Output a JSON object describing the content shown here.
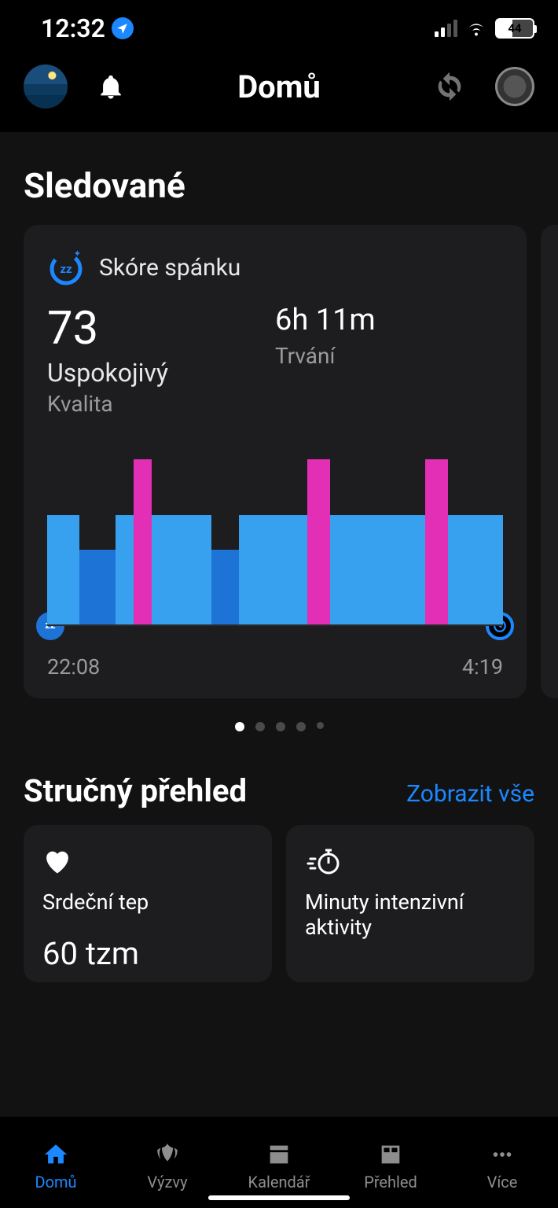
{
  "status": {
    "time": "12:32",
    "battery": "44"
  },
  "header": {
    "title": "Domů"
  },
  "sections": {
    "watched_title": "Sledované",
    "overview_title": "Stručný přehled",
    "show_all": "Zobrazit vše"
  },
  "sleep_card": {
    "title": "Skóre spánku",
    "score": "73",
    "quality_value": "Uspokojivý",
    "quality_label": "Kvalita",
    "duration_value": "6h 11m",
    "duration_label": "Trvání",
    "time_start": "22:08",
    "time_end": "4:19"
  },
  "chart_data": {
    "type": "bar",
    "title": "Skóre spánku",
    "x_start": "22:08",
    "x_end": "4:19",
    "xlabel": "",
    "ylabel": "",
    "legend": {
      "deep": "#1e74d6",
      "light": "#37a1f0",
      "rem": "#e22fb6"
    },
    "segments": [
      {
        "stage": "light",
        "left_pct": 0,
        "width_pct": 7,
        "height": 0.66
      },
      {
        "stage": "deep",
        "left_pct": 7,
        "width_pct": 8,
        "height": 0.45
      },
      {
        "stage": "light",
        "left_pct": 15,
        "width_pct": 4,
        "height": 0.66
      },
      {
        "stage": "rem",
        "left_pct": 19,
        "width_pct": 4,
        "height": 1.0
      },
      {
        "stage": "light",
        "left_pct": 23,
        "width_pct": 13,
        "height": 0.66
      },
      {
        "stage": "deep",
        "left_pct": 36,
        "width_pct": 6,
        "height": 0.45
      },
      {
        "stage": "light",
        "left_pct": 42,
        "width_pct": 15,
        "height": 0.66
      },
      {
        "stage": "rem",
        "left_pct": 57,
        "width_pct": 5,
        "height": 1.0
      },
      {
        "stage": "light",
        "left_pct": 62,
        "width_pct": 21,
        "height": 0.66
      },
      {
        "stage": "rem",
        "left_pct": 83,
        "width_pct": 5,
        "height": 1.0
      },
      {
        "stage": "light",
        "left_pct": 88,
        "width_pct": 12,
        "height": 0.66
      }
    ]
  },
  "pager": {
    "count": 5,
    "active": 0
  },
  "small_cards": {
    "hr_title": "Srdeční tep",
    "hr_value": "60 tzm",
    "intensity_title": "Minuty intenzivní aktivity"
  },
  "tabs": {
    "home": "Domů",
    "challenges": "Výzvy",
    "calendar": "Kalendář",
    "overview": "Přehled",
    "more": "Více"
  }
}
